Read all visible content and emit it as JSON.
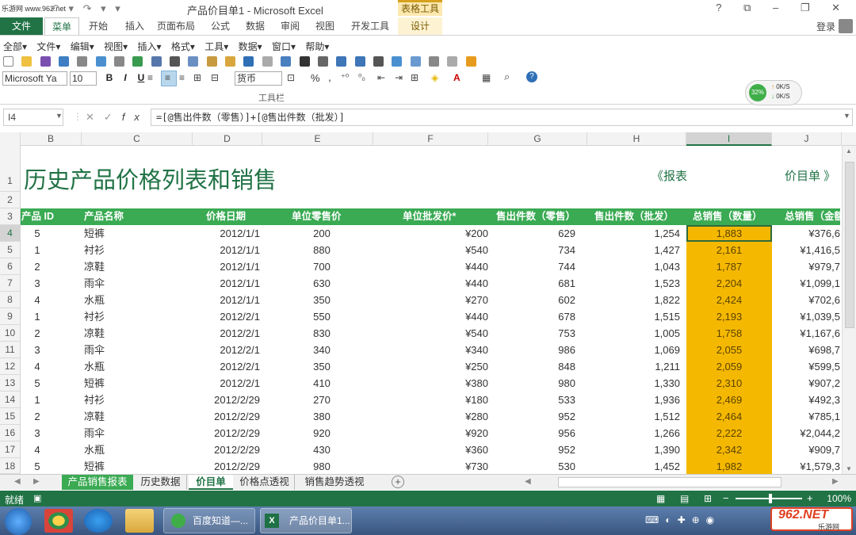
{
  "window": {
    "watermark": "乐游网 www.962.net",
    "title": "产品价目单1 - Microsoft Excel",
    "table_tools": "表格工具",
    "controls": "? ⧉ – ❐ ✕"
  },
  "ribbon_tabs": {
    "file": "文件",
    "tabs": [
      "菜单",
      "开始",
      "插入",
      "页面布局",
      "公式",
      "数据",
      "审阅",
      "视图",
      "开发工具",
      "设计"
    ],
    "login": "登录"
  },
  "classic_menu": [
    "全部▾",
    "文件▾",
    "编辑▾",
    "视图▾",
    "插入▾",
    "格式▾",
    "工具▾",
    "数据▾",
    "窗口▾",
    "帮助▾"
  ],
  "toolbar": {
    "font": "Microsoft Ya",
    "size": "10",
    "bold": "B",
    "italic": "I",
    "underline": "U",
    "number_format": "货币",
    "percent": "%",
    "comma": ",",
    "label": "工具栏"
  },
  "net_monitor": {
    "percent": "32%",
    "up": "0K/S",
    "down": "0K/S"
  },
  "formula_bar": {
    "name_box": "I4",
    "formula": "=[@售出件数（零售）]+[@售出件数（批发）]"
  },
  "columns": [
    "B",
    "C",
    "D",
    "E",
    "F",
    "G",
    "H",
    "I",
    "J"
  ],
  "selected_column": "I",
  "rows": [
    "1",
    "2",
    "3",
    "4",
    "5",
    "6",
    "7",
    "8",
    "9",
    "10",
    "11",
    "12",
    "13",
    "14",
    "15",
    "16",
    "17",
    "18"
  ],
  "selected_row": "4",
  "sheet": {
    "title": "历史产品价格列表和销售",
    "nav_report": "《报表",
    "nav_price": "价目单 》",
    "headers": [
      "产品 ID",
      "产品名称",
      "价格日期",
      "单位零售价",
      "单位批发价*",
      "售出件数（零售）",
      "售出件数（批发）",
      "总销售（数量）",
      "总销售（金额"
    ],
    "data": [
      [
        "5",
        "短裤",
        "2012/1/1",
        "200",
        "¥200",
        "629",
        "1,254",
        "1,883",
        "¥376,6"
      ],
      [
        "1",
        "衬衫",
        "2012/1/1",
        "880",
        "¥540",
        "734",
        "1,427",
        "2,161",
        "¥1,416,5"
      ],
      [
        "2",
        "凉鞋",
        "2012/1/1",
        "700",
        "¥440",
        "744",
        "1,043",
        "1,787",
        "¥979,7"
      ],
      [
        "3",
        "雨伞",
        "2012/1/1",
        "630",
        "¥440",
        "681",
        "1,523",
        "2,204",
        "¥1,099,1"
      ],
      [
        "4",
        "水瓶",
        "2012/1/1",
        "350",
        "¥270",
        "602",
        "1,822",
        "2,424",
        "¥702,6"
      ],
      [
        "1",
        "衬衫",
        "2012/2/1",
        "550",
        "¥440",
        "678",
        "1,515",
        "2,193",
        "¥1,039,5"
      ],
      [
        "2",
        "凉鞋",
        "2012/2/1",
        "830",
        "¥540",
        "753",
        "1,005",
        "1,758",
        "¥1,167,6"
      ],
      [
        "3",
        "雨伞",
        "2012/2/1",
        "340",
        "¥340",
        "986",
        "1,069",
        "2,055",
        "¥698,7"
      ],
      [
        "4",
        "水瓶",
        "2012/2/1",
        "350",
        "¥250",
        "848",
        "1,211",
        "2,059",
        "¥599,5"
      ],
      [
        "5",
        "短裤",
        "2012/2/1",
        "410",
        "¥380",
        "980",
        "1,330",
        "2,310",
        "¥907,2"
      ],
      [
        "1",
        "衬衫",
        "2012/2/29",
        "270",
        "¥180",
        "533",
        "1,936",
        "2,469",
        "¥492,3"
      ],
      [
        "2",
        "凉鞋",
        "2012/2/29",
        "380",
        "¥280",
        "952",
        "1,512",
        "2,464",
        "¥785,1"
      ],
      [
        "3",
        "雨伞",
        "2012/2/29",
        "920",
        "¥920",
        "956",
        "1,266",
        "2,222",
        "¥2,044,2"
      ],
      [
        "4",
        "水瓶",
        "2012/2/29",
        "430",
        "¥360",
        "952",
        "1,390",
        "2,342",
        "¥909,7"
      ],
      [
        "5",
        "短裤",
        "2012/2/29",
        "980",
        "¥730",
        "530",
        "1,452",
        "1,982",
        "¥1,579,3"
      ]
    ]
  },
  "sheet_tabs": [
    "产品销售报表",
    "历史数据",
    "价目单",
    "价格点透视",
    "销售趋势透视"
  ],
  "active_sheet_tab": "价目单",
  "status": {
    "ready": "就绪",
    "zoom": "100%"
  },
  "taskbar": {
    "task1": "百度知道—...",
    "task2": "产品价目单1...",
    "brand": "962.NET",
    "brand_sub": "乐游网"
  }
}
